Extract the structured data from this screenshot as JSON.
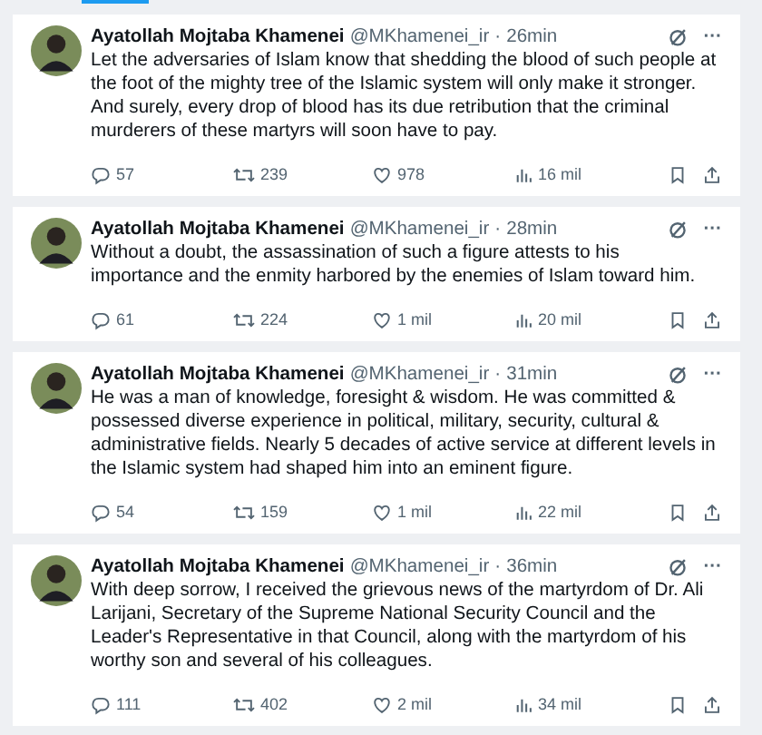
{
  "posts": [
    {
      "name": "Ayatollah Mojtaba Khamenei",
      "handle": "@MKhamenei_ir",
      "separator": "·",
      "time": "26min",
      "more": "···",
      "text": "Let the adversaries of Islam know that shedding the blood of such people at the foot of the mighty tree of the Islamic system will only make it stronger. And surely, every drop of blood has its due retribution that the criminal murderers of these martyrs will soon have to pay.",
      "replies": "57",
      "reposts": "239",
      "likes": "978",
      "views": "16 mil"
    },
    {
      "name": "Ayatollah Mojtaba Khamenei",
      "handle": "@MKhamenei_ir",
      "separator": "·",
      "time": "28min",
      "more": "···",
      "text": "Without a doubt, the assassination of such a figure attests to his importance and the enmity harbored by the enemies of Islam toward him.",
      "replies": "61",
      "reposts": "224",
      "likes": "1 mil",
      "views": "20 mil"
    },
    {
      "name": "Ayatollah Mojtaba Khamenei",
      "handle": "@MKhamenei_ir",
      "separator": "·",
      "time": "31min",
      "more": "···",
      "text": "He was a man of knowledge, foresight & wisdom. He was committed & possessed diverse experience in political, military, security, cultural & administrative fields. Nearly 5 decades of active service at different levels in the Islamic system had shaped him into an eminent figure.",
      "replies": "54",
      "reposts": "159",
      "likes": "1 mil",
      "views": "22 mil"
    },
    {
      "name": "Ayatollah Mojtaba Khamenei",
      "handle": "@MKhamenei_ir",
      "separator": "·",
      "time": "36min",
      "more": "···",
      "text": "With deep sorrow, I received the grievous news of the martyrdom of Dr. Ali Larijani, Secretary of the Supreme National Security Council and the Leader's Representative in that Council, along with the martyrdom of his worthy son and several of his colleagues.",
      "replies": "111",
      "reposts": "402",
      "likes": "2 mil",
      "views": "34 mil"
    }
  ]
}
